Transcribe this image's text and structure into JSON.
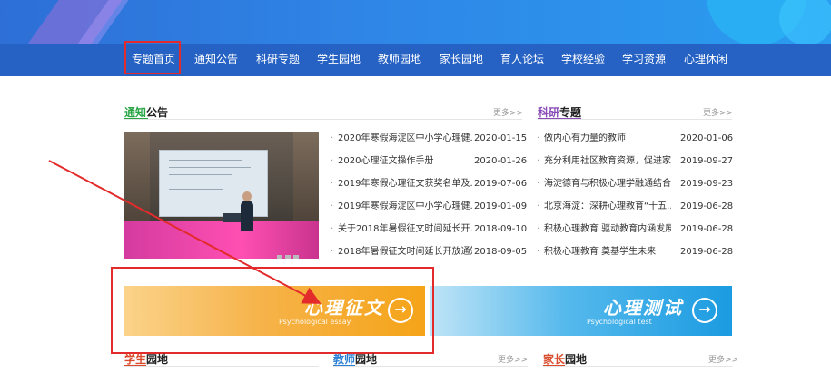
{
  "nav": {
    "items": [
      "专题首页",
      "通知公告",
      "科研专题",
      "学生园地",
      "教师园地",
      "家长园地",
      "育人论坛",
      "学校经验",
      "学习资源",
      "心理休闲"
    ]
  },
  "notices": {
    "title_hl": "通知",
    "title_rest": "公告",
    "more": "更多>>",
    "items": [
      {
        "title": "2020年寒假海淀区中小学心理健...",
        "date": "2020-01-15"
      },
      {
        "title": "2020心理征文操作手册",
        "date": "2020-01-26"
      },
      {
        "title": "2019年寒假心理征文获奖名单及...",
        "date": "2019-07-06"
      },
      {
        "title": "2019年寒假海淀区中小学心理健...",
        "date": "2019-01-09"
      },
      {
        "title": "关于2018年暑假征文时间延长开...",
        "date": "2018-09-10"
      },
      {
        "title": "2018年暑假征文时间延长开放通知",
        "date": "2018-09-05"
      }
    ]
  },
  "research": {
    "title_hl": "科研",
    "title_rest": "专题",
    "more": "更多>>",
    "items": [
      {
        "title": "做内心有力量的教师",
        "date": "2020-01-06"
      },
      {
        "title": "充分利用社区教育资源，促进家...",
        "date": "2019-09-27"
      },
      {
        "title": "海淀德育与积极心理学融通结合",
        "date": "2019-09-23"
      },
      {
        "title": "北京海淀：深耕心理教育“十五...",
        "date": "2019-06-28"
      },
      {
        "title": "积极心理教育 驱动教育内涵发展",
        "date": "2019-06-28"
      },
      {
        "title": "积极心理教育 奠基学生未来",
        "date": "2019-06-28"
      }
    ]
  },
  "promos": {
    "essay": {
      "title": "心理征文",
      "subtitle": "Psychological essay",
      "arrow": "→"
    },
    "test": {
      "title": "心理测试",
      "subtitle": "Psychological test",
      "arrow": "→"
    }
  },
  "bottom": {
    "students": {
      "title_hl": "学生",
      "title_rest": "园地"
    },
    "teachers": {
      "title_hl": "教师",
      "title_rest": "园地",
      "more": "更多>>"
    },
    "parents": {
      "title_hl": "家长",
      "title_rest": "园地",
      "more": "更多>>"
    }
  },
  "colors": {
    "nav_bg": "#2662c4",
    "highlight_box": "#e32b2b",
    "arrow": "#e32b2b"
  }
}
